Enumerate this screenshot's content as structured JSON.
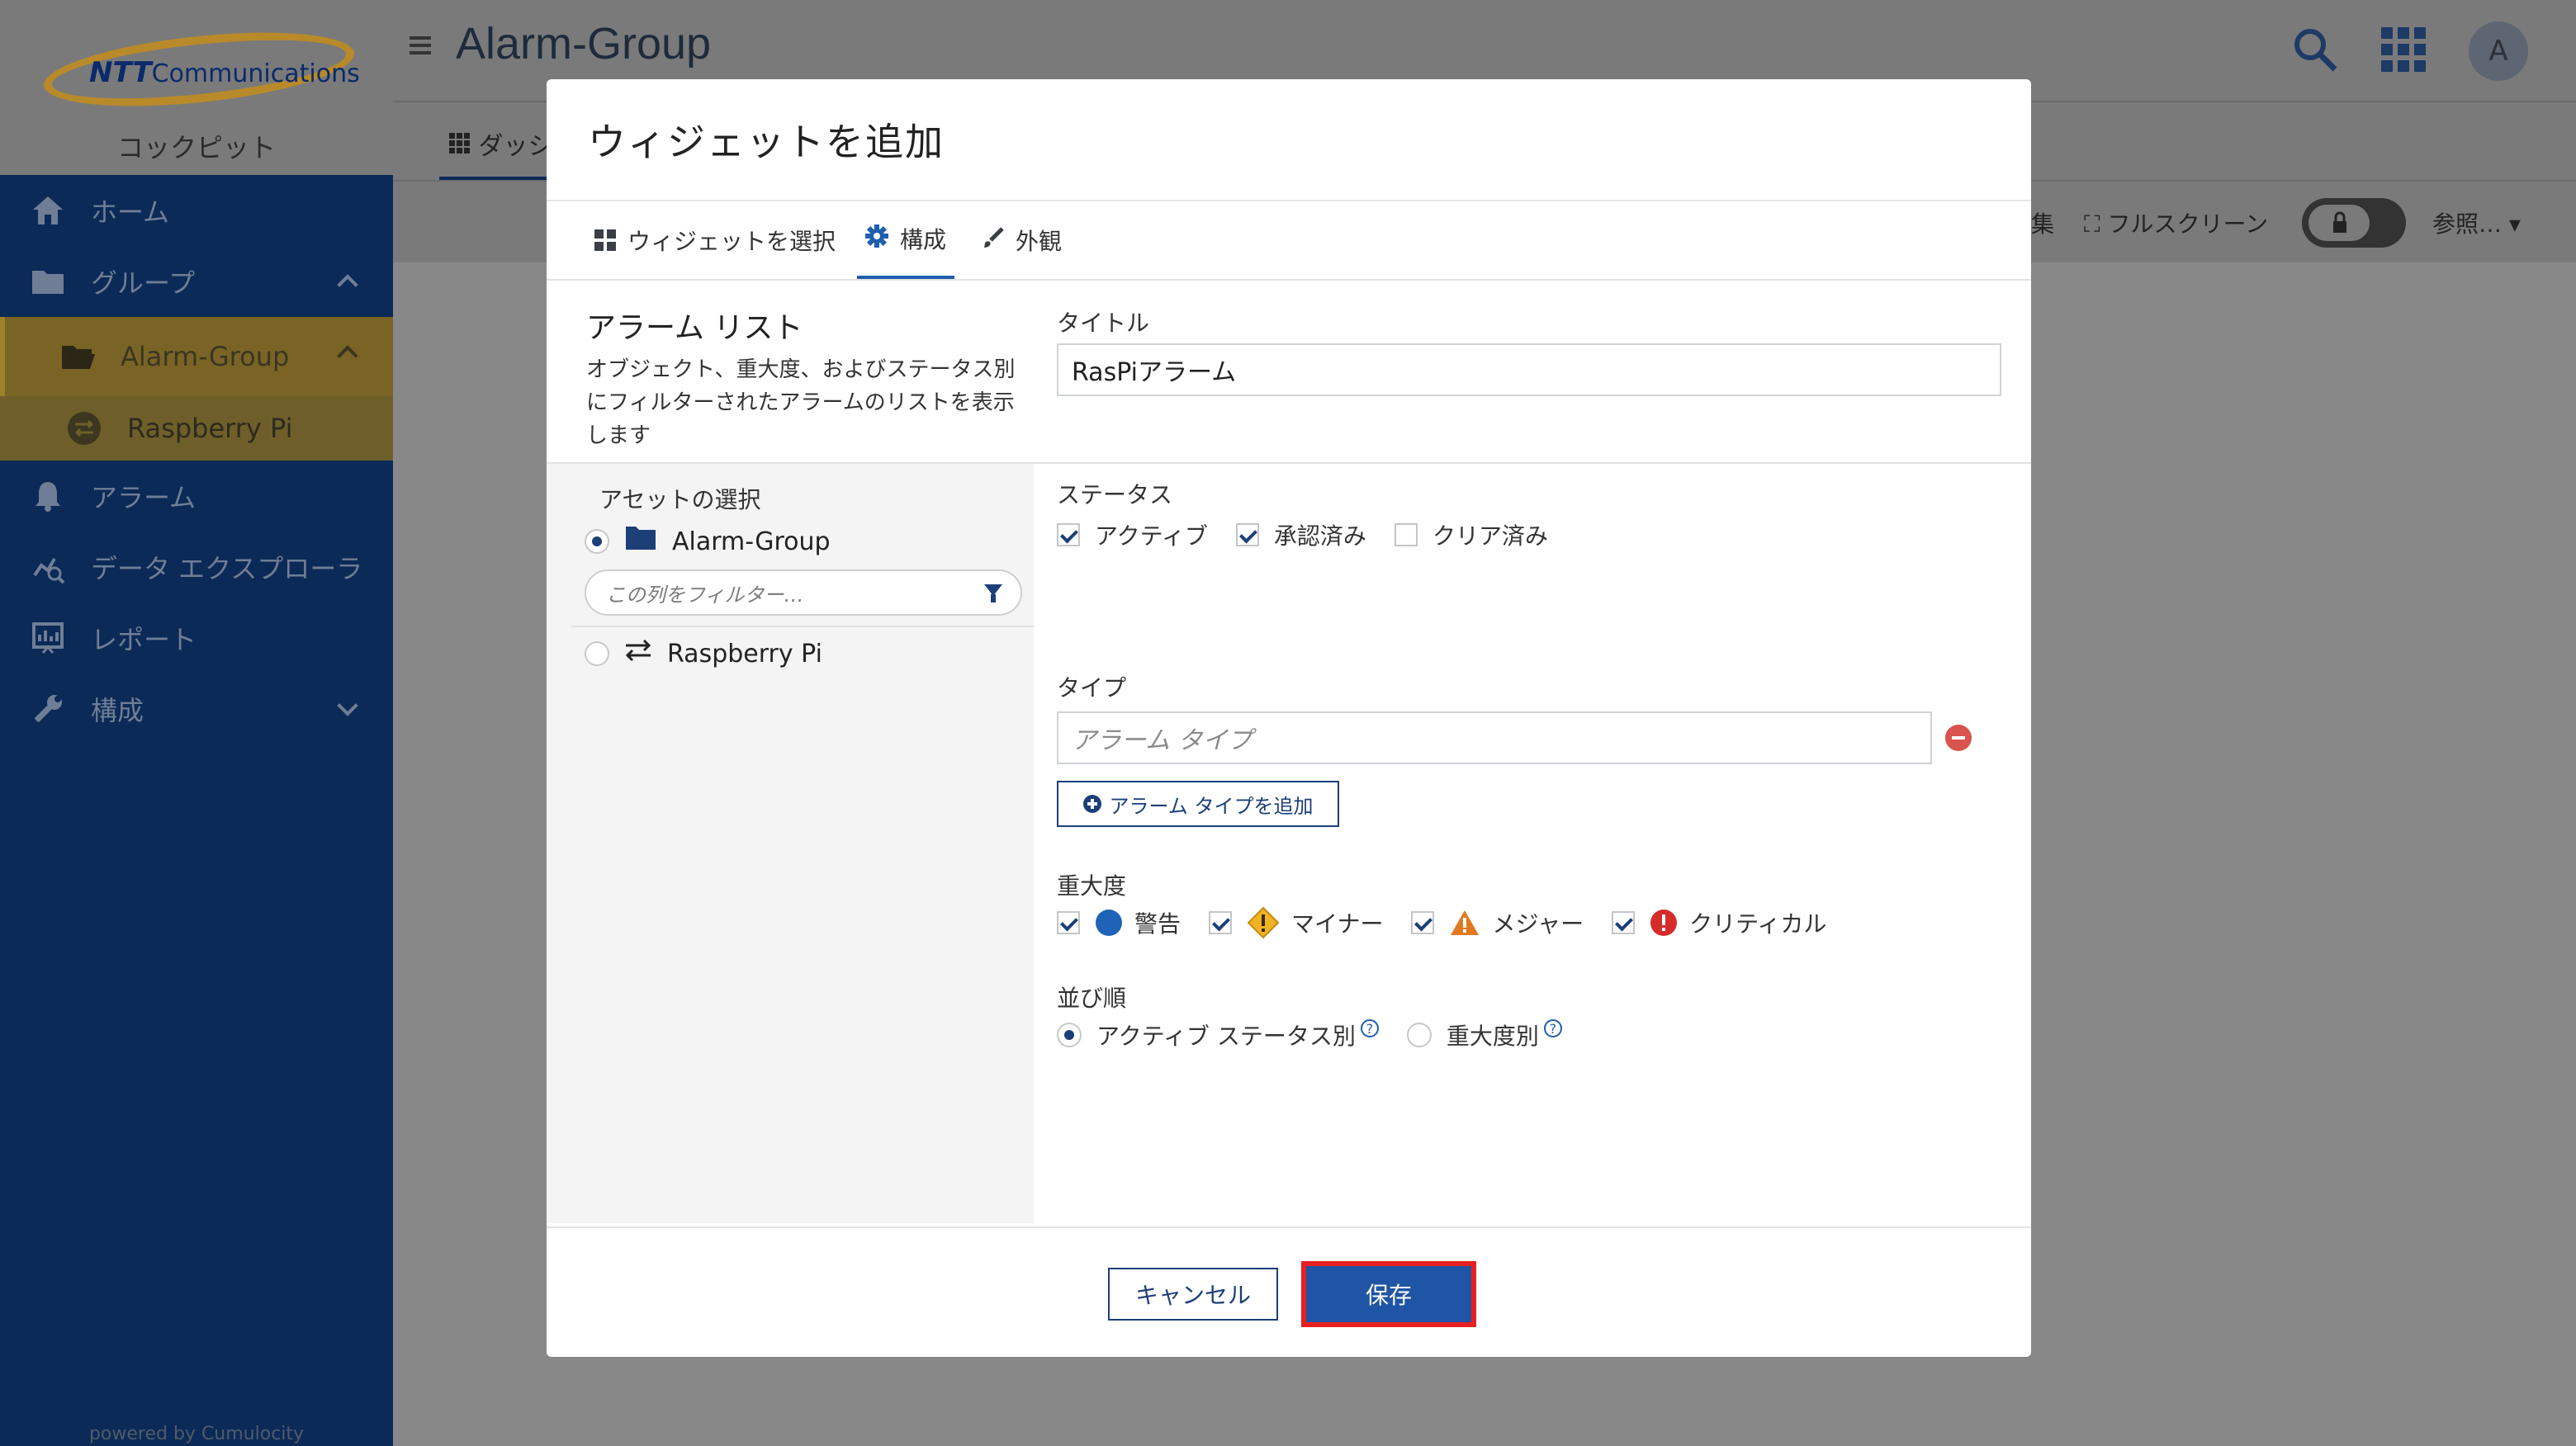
{
  "brand": {
    "logo_text": "Communications",
    "logo_prefix": "NTT",
    "app_name": "コックピット",
    "powered_by": "powered by Cumulocity"
  },
  "sidebar": {
    "items": [
      {
        "label": "ホーム"
      },
      {
        "label": "グループ"
      },
      {
        "label": "Alarm-Group"
      },
      {
        "label": "Raspberry Pi"
      },
      {
        "label": "アラーム"
      },
      {
        "label": "データ エクスプローラ"
      },
      {
        "label": "レポート"
      },
      {
        "label": "構成"
      }
    ]
  },
  "header": {
    "title": "Alarm-Group",
    "avatar_initial": "A"
  },
  "dashboard": {
    "tab_label": "ダッシ",
    "edit_label": "集",
    "fullscreen_label": "フルスクリーン",
    "ref_label": "参照…"
  },
  "modal": {
    "title": "ウィジェットを追加",
    "tabs": [
      {
        "label": "ウィジェットを選択"
      },
      {
        "label": "構成"
      },
      {
        "label": "外観"
      }
    ],
    "widget": {
      "name": "アラーム リスト",
      "description": "オブジェクト、重大度、およびステータス別にフィルターされたアラームのリストを表示します"
    },
    "assets": {
      "title": "アセットの選択",
      "group": "Alarm-Group",
      "filter_placeholder": "この列をフィルター…",
      "device": "Raspberry Pi"
    },
    "title_field": {
      "label": "タイトル",
      "value": "RasPiアラーム"
    },
    "status": {
      "label": "ステータス",
      "options": [
        {
          "label": "アクティブ",
          "checked": true
        },
        {
          "label": "承認済み",
          "checked": true
        },
        {
          "label": "クリア済み",
          "checked": false
        }
      ]
    },
    "type": {
      "label": "タイプ",
      "placeholder": "アラーム タイプ",
      "add_label": "アラーム タイプを追加"
    },
    "severity": {
      "label": "重大度",
      "options": [
        {
          "label": "警告",
          "checked": true,
          "color": "#1f63b8"
        },
        {
          "label": "マイナー",
          "checked": true,
          "color": "#f0b323"
        },
        {
          "label": "メジャー",
          "checked": true,
          "color": "#e07a1f"
        },
        {
          "label": "クリティカル",
          "checked": true,
          "color": "#d62b2b"
        }
      ]
    },
    "order": {
      "label": "並び順",
      "options": [
        {
          "label": "アクティブ ステータス別",
          "selected": true
        },
        {
          "label": "重大度別",
          "selected": false
        }
      ]
    },
    "footer": {
      "cancel_label": "キャンセル",
      "save_label": "保存"
    }
  }
}
